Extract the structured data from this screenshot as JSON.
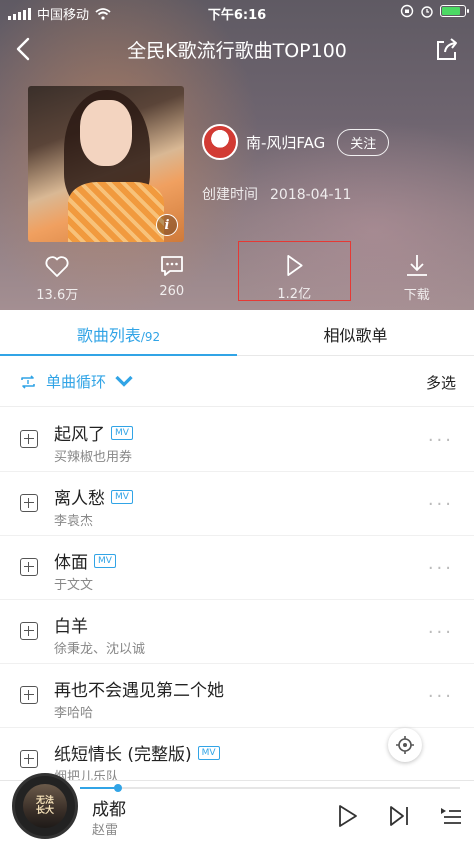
{
  "status": {
    "carrier": "中国移动",
    "time": "下午6:16"
  },
  "nav": {
    "title": "全民K歌流行歌曲TOP100"
  },
  "creator": {
    "name": "南-风归FAG",
    "follow_label": "关注",
    "created_label": "创建时间",
    "created_date": "2018-04-11"
  },
  "actions": [
    {
      "label": "13.6万",
      "icon": "heart-icon"
    },
    {
      "label": "260",
      "icon": "comment-icon"
    },
    {
      "label": "1.2亿",
      "icon": "play-icon"
    },
    {
      "label": "下载",
      "icon": "download-icon"
    }
  ],
  "tabs": {
    "songs_label": "歌曲列表",
    "songs_count": "/92",
    "similar_label": "相似歌单"
  },
  "toolbar": {
    "mode_label": "单曲循环",
    "multi_label": "多选"
  },
  "songs": [
    {
      "title": "起风了",
      "artist": "买辣椒也用券",
      "mv": "MV"
    },
    {
      "title": "离人愁",
      "artist": "李袁杰",
      "mv": "MV"
    },
    {
      "title": "体面",
      "artist": "于文文",
      "mv": "MV"
    },
    {
      "title": "白羊",
      "artist": "徐秉龙、沈以诚",
      "mv": ""
    },
    {
      "title": "再也不会遇见第二个她",
      "artist": "李哈哈",
      "mv": ""
    },
    {
      "title": "纸短情长 (完整版)",
      "artist": "烟把儿乐队",
      "mv": "MV"
    }
  ],
  "player": {
    "title": "成都",
    "artist": "赵雷",
    "disc_label": "无法长大",
    "progress": 0.1
  },
  "colors": {
    "accent": "#31a4e6",
    "highlight": "#e53935"
  }
}
